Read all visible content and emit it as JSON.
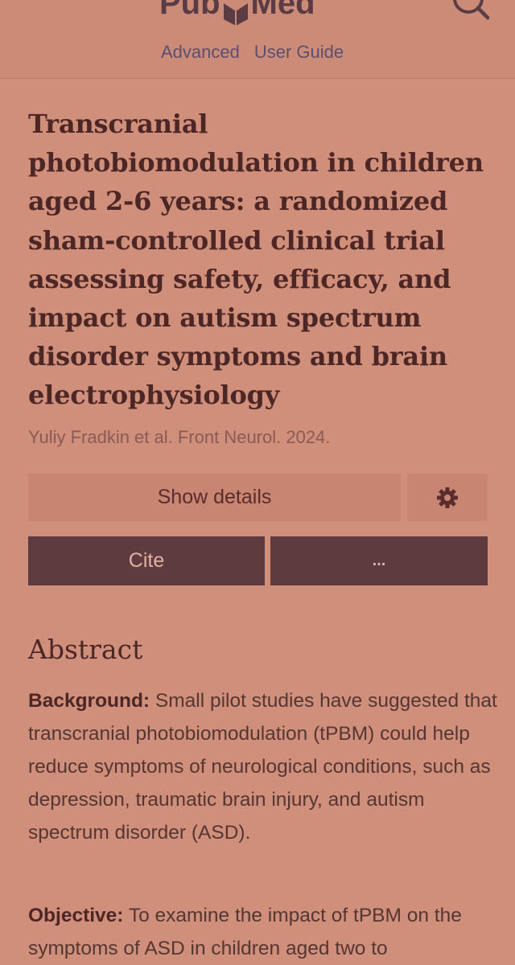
{
  "header": {
    "logo_text_left": "Pub",
    "logo_text_right": "Med",
    "links": [
      "Advanced",
      "User Guide"
    ],
    "search_icon": "search-icon"
  },
  "article": {
    "title": "Transcranial photobiomodulation in children aged 2-6 years: a randomized sham-controlled clinical trial assessing safety, efficacy, and impact on autism spectrum disorder symptoms and brain electrophysiology",
    "citation": "Yuliy Fradkin et al. Front Neurol. 2024."
  },
  "actions": {
    "show_details": "Show details",
    "settings_icon": "gear-icon",
    "cite": "Cite",
    "more": "..."
  },
  "abstract": {
    "heading": "Abstract",
    "background_label": "Background:",
    "background_text": "Small pilot studies have suggested that transcranial photobiomodulation (tPBM) could help reduce symptoms of neurological conditions, such as depression, traumatic brain injury, and autism spectrum disorder (ASD).",
    "objective_label": "Objective:",
    "objective_text": "To examine the impact of tPBM on the symptoms of ASD in children aged two to"
  },
  "colors": {
    "background": "#cf8f7a",
    "button_dark": "#5e3b3f",
    "button_light": "#c78572",
    "title_text": "#4d2626"
  }
}
